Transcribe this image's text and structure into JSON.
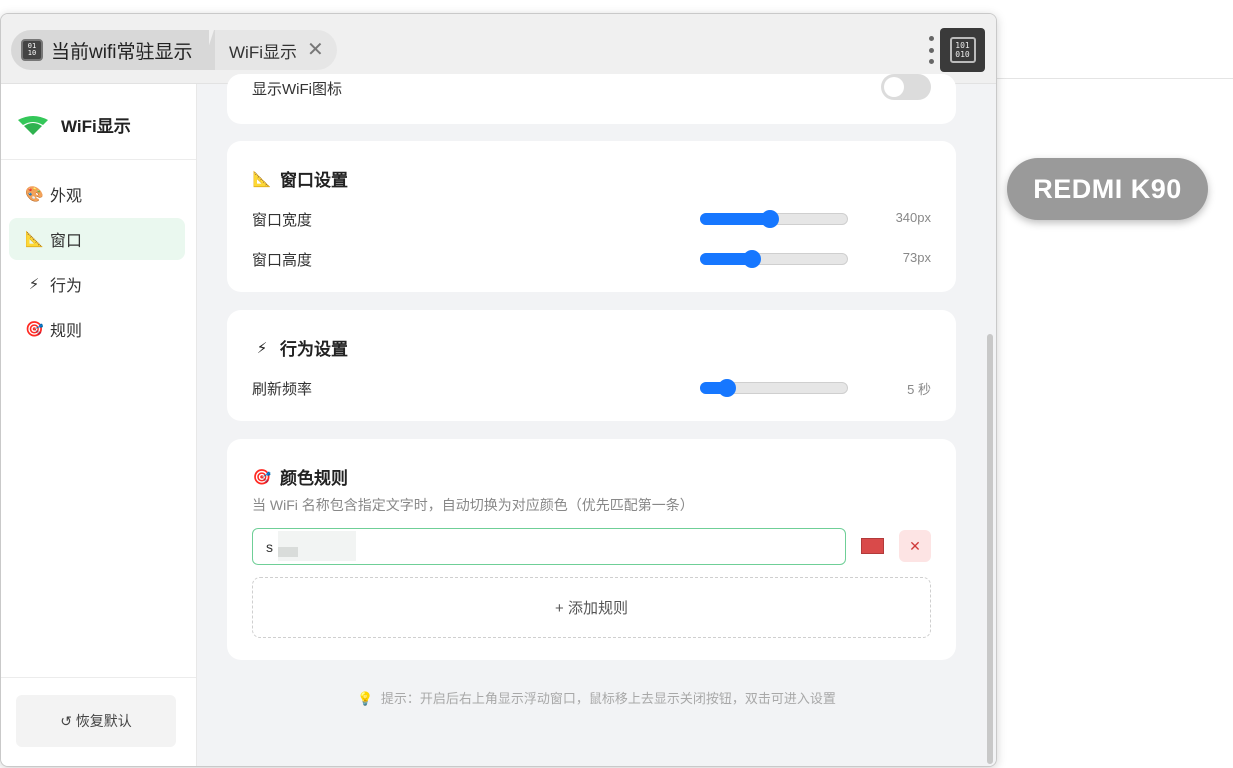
{
  "browser": {
    "active_tab": "当前wifi常驻显示",
    "active_tab_icon": "binary-icon",
    "second_tab": "WiFi显示",
    "second_tab_close": "✕",
    "extension_glyph": "101\n010"
  },
  "float_window": {
    "text": "REDMI K90",
    "background": "#9a9a9a"
  },
  "sidebar": {
    "brand": "WiFi显示",
    "brand_color": "#34c759",
    "items": [
      {
        "icon": "palette-icon",
        "glyph": "🎨",
        "label": "外观",
        "active": false
      },
      {
        "icon": "triangle-ruler-icon",
        "glyph": "📐",
        "label": "窗口",
        "active": true
      },
      {
        "icon": "lightning-icon",
        "glyph": "⚡",
        "label": "行为",
        "active": false
      },
      {
        "icon": "target-icon",
        "glyph": "🎯",
        "label": "规则",
        "active": false
      }
    ],
    "reset_label": "↺ 恢复默认"
  },
  "appearance": {
    "partial_row_label": "显示WiFi图标",
    "toggle_on": false
  },
  "window_settings": {
    "title": "窗口设置",
    "icon": "📐",
    "rows": [
      {
        "label": "窗口宽度",
        "value_text": "340px",
        "fraction": 0.47
      },
      {
        "label": "窗口高度",
        "value_text": "73px",
        "fraction": 0.35
      }
    ]
  },
  "behavior_settings": {
    "title": "行为设置",
    "icon": "⚡",
    "rows": [
      {
        "label": "刷新频率",
        "value_text": "5 秒",
        "fraction": 0.18
      }
    ]
  },
  "color_rules": {
    "title": "颜色规则",
    "icon": "🎯",
    "description": "当 WiFi 名称包含指定文字时，自动切换为对应颜色（优先匹配第一条）",
    "rules": [
      {
        "text": "s",
        "color": "#d94a4a",
        "delete_label": "✕"
      }
    ],
    "add_label": "+ 添加规则"
  },
  "tip": {
    "icon": "💡",
    "text": "提示：开启后右上角显示浮动窗口，鼠标移上去显示关闭按钮，双击可进入设置"
  },
  "colors": {
    "accent": "#1677ff",
    "success": "#34c759",
    "danger": "#d94a4a"
  }
}
